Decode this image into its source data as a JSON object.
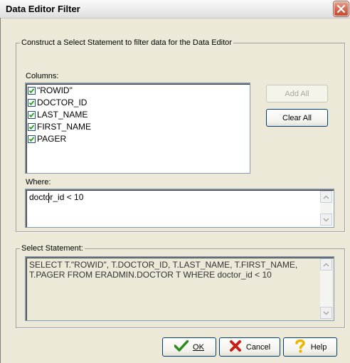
{
  "window": {
    "title": "Data Editor Filter",
    "close_icon": "close-icon"
  },
  "construct_group": {
    "legend": "Construct a Select Statement to filter data for the Data Editor"
  },
  "columns": {
    "label": "Columns:",
    "items": [
      {
        "label": "\"ROWID\"",
        "checked": true
      },
      {
        "label": "DOCTOR_ID",
        "checked": true
      },
      {
        "label": "LAST_NAME",
        "checked": true
      },
      {
        "label": "FIRST_NAME",
        "checked": true
      },
      {
        "label": "PAGER",
        "checked": true
      }
    ]
  },
  "buttons": {
    "add_all": "Add All",
    "clear_all": "Clear All",
    "ok": "OK",
    "cancel": "Cancel",
    "help": "Help"
  },
  "where": {
    "label": "Where:",
    "value": "doctor_id < 10"
  },
  "select_statement": {
    "legend": "Select Statement:",
    "line1": "SELECT T.\"ROWID\", T.DOCTOR_ID, T.LAST_NAME, T.FIRST_NAME,",
    "line2": "T.PAGER FROM ERADMIN.DOCTOR T WHERE doctor_id < 10"
  },
  "colors": {
    "ok_icon": "#2e8b1e",
    "cancel_icon": "#c81e14",
    "help_icon": "#f0b400"
  }
}
